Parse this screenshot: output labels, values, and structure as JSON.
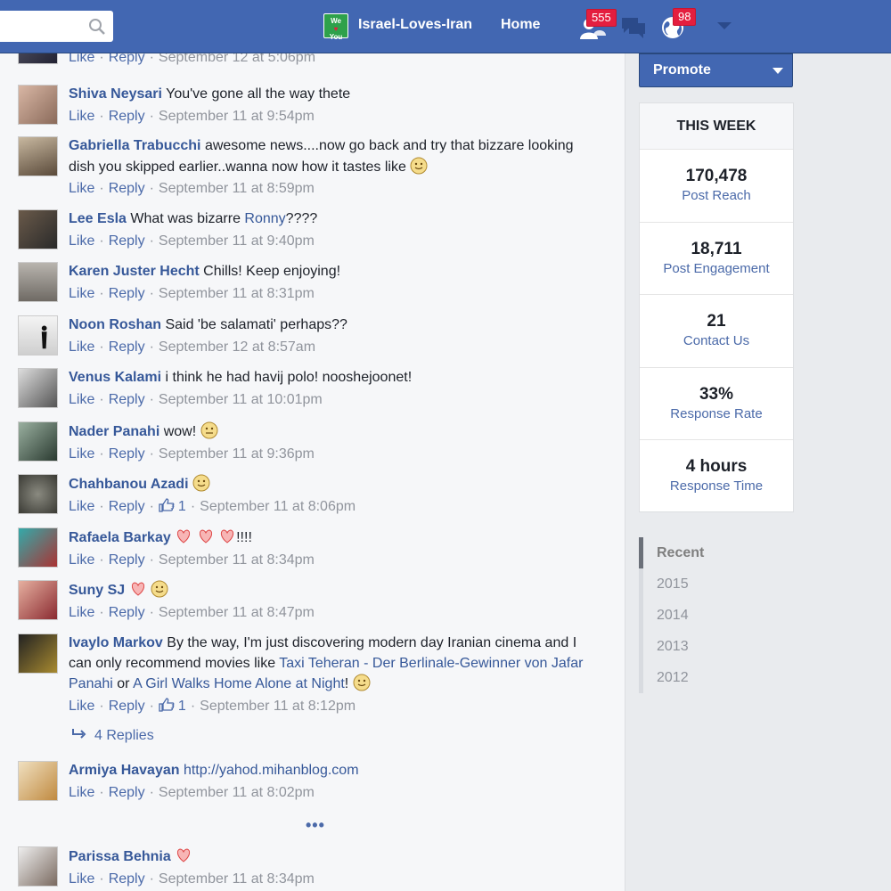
{
  "topbar": {
    "page_name": "Israel-Loves-Iran",
    "page_badge_line1": "We",
    "page_badge_line2": "♥",
    "page_badge_line3": "You",
    "home_label": "Home",
    "friends_count": "555",
    "notifications_count": "98"
  },
  "comments": [
    {
      "author": "",
      "text": "",
      "meta": [
        "Like",
        "Reply",
        "September 12 at 5:06pm"
      ]
    },
    {
      "author": "Shiva Neysari",
      "text": " You've gone all the way thete",
      "meta": [
        "Like",
        "Reply",
        "September 11 at 9:54pm"
      ]
    },
    {
      "author": "Gabriella Trabucchi",
      "text": " awesome news....now go back and try that bizzare looking dish you skipped earlier..wanna now how it tastes like",
      "meta": [
        "Like",
        "Reply",
        "September 11 at 8:59pm"
      ]
    },
    {
      "author": "Lee Esla",
      "text": " What was bizarre ",
      "link": "Ronny",
      "text_after": "????",
      "meta": [
        "Like",
        "Reply",
        "September 11 at 9:40pm"
      ]
    },
    {
      "author": "Karen Juster Hecht",
      "text": " Chills! Keep enjoying!",
      "meta": [
        "Like",
        "Reply",
        "September 11 at 8:31pm"
      ]
    },
    {
      "author": "Noon Roshan",
      "text": " Said 'be salamati' perhaps??",
      "meta": [
        "Like",
        "Reply",
        "September 12 at 8:57am"
      ]
    },
    {
      "author": "Venus Kalami",
      "text": " i think he had havij polo! nooshejoonet!",
      "meta": [
        "Like",
        "Reply",
        "September 11 at 10:01pm"
      ]
    },
    {
      "author": "Nader Panahi",
      "text": " wow!",
      "meta": [
        "Like",
        "Reply",
        "September 11 at 9:36pm"
      ]
    },
    {
      "author": "Chahbanou Azadi",
      "text": "",
      "meta": [
        "Like",
        "Reply",
        "September 11 at 8:06pm"
      ],
      "likes": "1"
    },
    {
      "author": "Rafaela Barkay",
      "text": "!!!!",
      "meta": [
        "Like",
        "Reply",
        "September 11 at 8:34pm"
      ]
    },
    {
      "author": "Suny SJ",
      "text": "",
      "meta": [
        "Like",
        "Reply",
        "September 11 at 8:47pm"
      ]
    },
    {
      "author": "Ivaylo Markov",
      "text": " By the way, I'm just discovering modern day Iranian cinema and I can only recommend movies like ",
      "link": "Taxi Teheran - Der Berlinale-Gewinner von Jafar Panahi",
      "text_mid": " or ",
      "link2": "A Girl Walks Home Alone at Night",
      "text_after": "!",
      "meta": [
        "Like",
        "Reply",
        "September 11 at 8:12pm"
      ],
      "likes": "1"
    },
    {
      "author": "Armiya Havayan",
      "text": " http://yahod.mihanblog.com",
      "meta": [
        "Like",
        "Reply",
        "September 11 at 8:02pm"
      ]
    },
    {
      "author": "Parissa Behnia",
      "text": "",
      "meta": [
        "Like",
        "Reply",
        "September 11 at 8:34pm"
      ]
    }
  ],
  "replies_label": "4 Replies",
  "more_label": "•••",
  "sidebar": {
    "promote_label": "Promote",
    "stats_title": "THIS WEEK",
    "stats": [
      {
        "value": "170,478",
        "label": "Post Reach"
      },
      {
        "value": "18,711",
        "label": "Post Engagement"
      },
      {
        "value": "21",
        "label": "Contact Us"
      },
      {
        "value": "33%",
        "label": "Response Rate"
      },
      {
        "value": "4 hours",
        "label": "Response Time"
      }
    ],
    "years": [
      "Recent",
      "2015",
      "2014",
      "2013",
      "2012"
    ]
  },
  "colors": {
    "brand": "#4267b2",
    "link": "#365899",
    "badge": "#e41e3f"
  }
}
